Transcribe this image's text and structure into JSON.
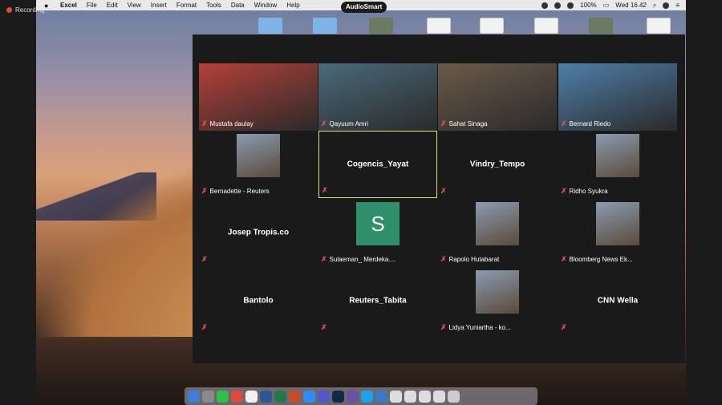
{
  "recording": {
    "label": "Recording"
  },
  "menubar": {
    "app": "Excel",
    "items": [
      "File",
      "Edit",
      "View",
      "Insert",
      "Format",
      "Tools",
      "Data",
      "Window",
      "Help"
    ],
    "battery": "100%",
    "clock": "Wed 16.42"
  },
  "audiosmart": {
    "label": "AudioSmart"
  },
  "participants": [
    {
      "name": "Mustafa daulay",
      "video": true
    },
    {
      "name": "Qayuum Amri",
      "video": true
    },
    {
      "name": "Sahat Sinaga",
      "video": true
    },
    {
      "name": "Bernard Riedo",
      "video": true
    },
    {
      "name": "Bernadette - Reuters",
      "thumb": true
    },
    {
      "name": "Cogencis_Yayat",
      "active": true
    },
    {
      "name": "Vindry_Tempo"
    },
    {
      "name": "Ridho Syukra",
      "thumb": true
    },
    {
      "name": "Josep Tropis.co"
    },
    {
      "name": "Sulaeman_ Merdeka....",
      "avatar_letter": "S"
    },
    {
      "name": "Rapolo Hutabarat",
      "thumb": true
    },
    {
      "name": "Bloomberg News Ek...",
      "thumb": true
    },
    {
      "name": "Bantolo"
    },
    {
      "name": "Reuters_Tabita"
    },
    {
      "name": "Lidya Yuniartha - ko...",
      "thumb": true
    },
    {
      "name": "CNN Wella"
    }
  ],
  "colors": {
    "active_border": "#d6e57a",
    "mic_off": "#e34d4d",
    "tile_bg": "#1a1a1a"
  }
}
